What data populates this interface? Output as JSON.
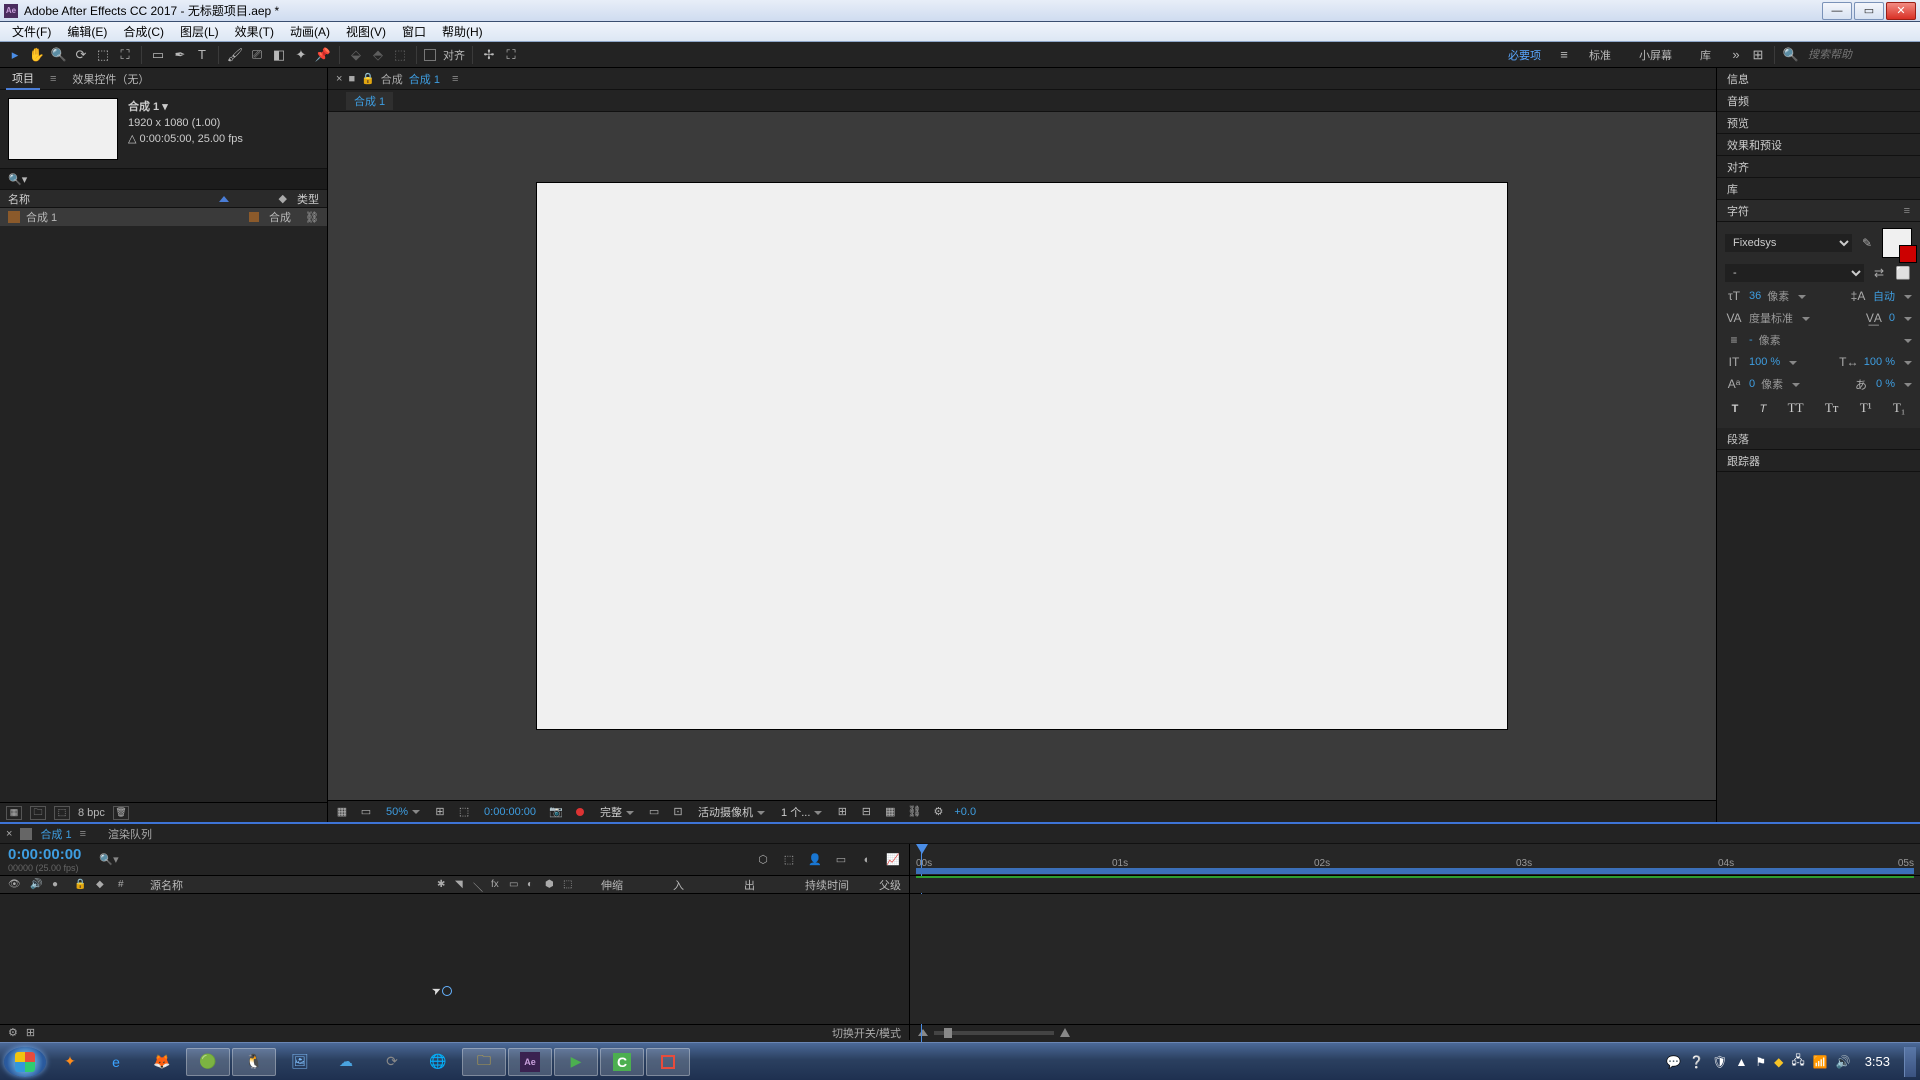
{
  "titlebar": {
    "title": "Adobe After Effects CC 2017 - 无标题项目.aep *"
  },
  "menu": {
    "file": "文件(F)",
    "edit": "编辑(E)",
    "comp": "合成(C)",
    "layer": "图层(L)",
    "effect": "效果(T)",
    "anim": "动画(A)",
    "view": "视图(V)",
    "window": "窗口",
    "help": "帮助(H)"
  },
  "toolbar": {
    "snap": "对齐",
    "workspace_current": "必要项",
    "ws_standard": "标准",
    "ws_small": "小屏幕",
    "ws_lib": "库",
    "search_ph": "搜索帮助"
  },
  "project": {
    "tab_project": "项目",
    "tab_fx": "效果控件（无）",
    "comp_name": "合成 1 ▾",
    "comp_dims": "1920 x 1080 (1.00)",
    "comp_dur": "△ 0:00:05:00, 25.00 fps",
    "col_name": "名称",
    "col_type": "类型",
    "item_name": "合成 1",
    "item_type": "合成",
    "bpc": "8 bpc"
  },
  "viewer": {
    "tab_label": "合成",
    "tab_name": "合成 1",
    "bar_comp": "合成 1",
    "zoom": "50%",
    "time": "0:00:00:00",
    "quality": "完整",
    "camera": "活动摄像机",
    "views": "1 个...",
    "exposure": "+0.0"
  },
  "right": {
    "info": "信息",
    "audio": "音频",
    "preview": "预览",
    "fxpresets": "效果和预设",
    "align": "对齐",
    "lib": "库",
    "char": "字符",
    "para": "段落",
    "tracker": "跟踪器",
    "font": "Fixedsys",
    "style": "-",
    "size": "36",
    "size_unit": "像素",
    "lead": "自动",
    "kern": "度量标准",
    "track": "0",
    "stroke": "-",
    "stroke_unit": "像素",
    "vscale": "100 %",
    "hscale": "100 %",
    "baseline": "0",
    "baseline_unit": "像素",
    "tsume": "0 %"
  },
  "timeline": {
    "tab_name": "合成 1",
    "render_queue": "渲染队列",
    "time": "0:00:00:00",
    "sub": "00000 (25.00 fps)",
    "col_source": "源名称",
    "col_stretch": "伸缩",
    "col_in": "入",
    "col_out": "出",
    "col_dur": "持续时间",
    "col_parent": "父级",
    "t0": "00s",
    "t1": "01s",
    "t2": "02s",
    "t3": "03s",
    "t4": "04s",
    "t5": "05s",
    "switches": "切换开关/模式"
  },
  "taskbar": {
    "clock": "3:53"
  }
}
